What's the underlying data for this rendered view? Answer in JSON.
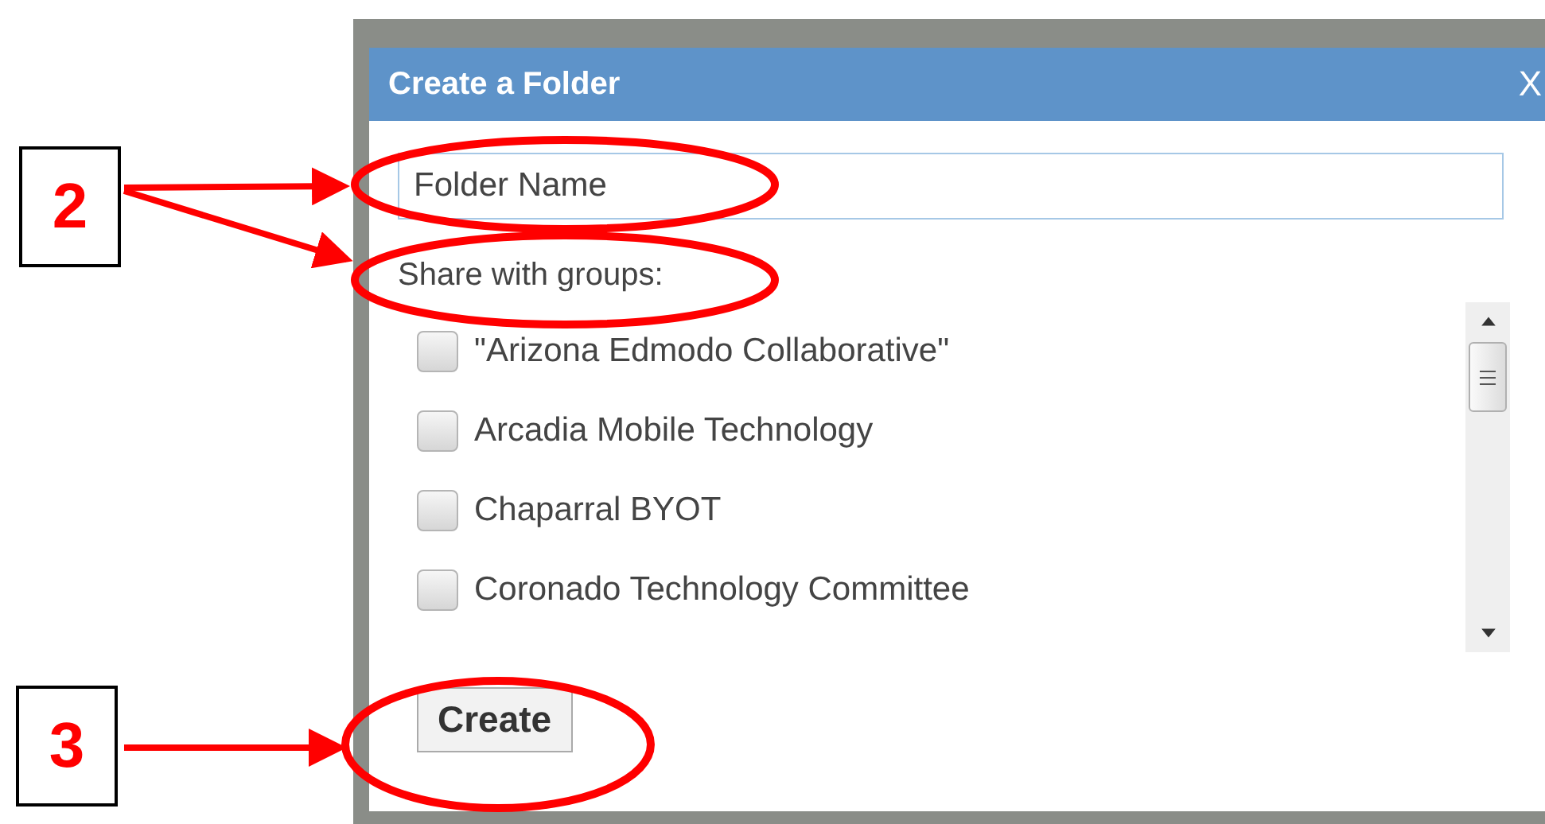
{
  "dialog": {
    "title": "Create a Folder",
    "close": "X",
    "name_field": {
      "placeholder": "Folder Name"
    },
    "groups_label": "Share with groups:",
    "groups": [
      {
        "name": "\"Arizona Edmodo Collaborative\"",
        "checked": false
      },
      {
        "name": "Arcadia Mobile Technology",
        "checked": false
      },
      {
        "name": "Chaparral BYOT",
        "checked": false
      },
      {
        "name": "Coronado Technology Committee",
        "checked": false
      }
    ],
    "create_button": "Create"
  },
  "annotations": {
    "callouts": [
      {
        "label": "2"
      },
      {
        "label": "3"
      }
    ]
  }
}
